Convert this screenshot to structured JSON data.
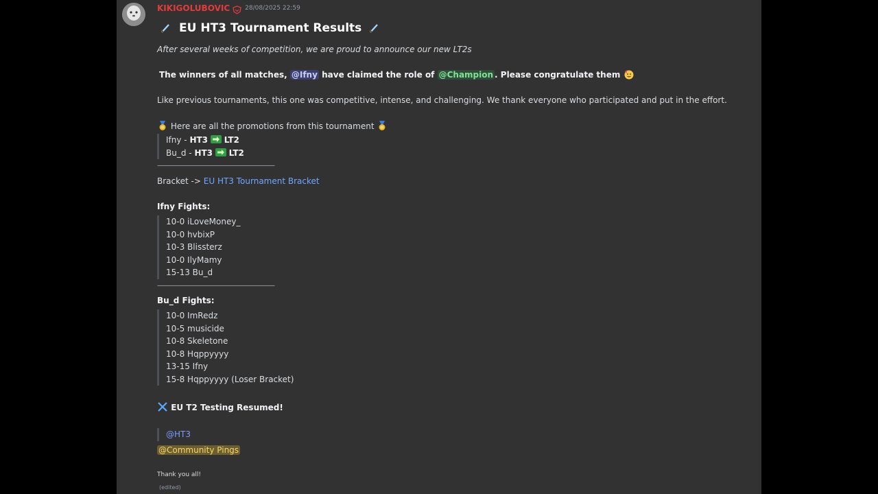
{
  "message": {
    "username": "KIKIGOLUBOVIC",
    "timestamp": "28/08/2025 22:59",
    "title": "EU HT3 Tournament Results",
    "intro": "After several weeks of competition, we are proud to announce our new LT2s",
    "winners": {
      "prefix": "The winners of all matches,",
      "mention_user": "@Ifny",
      "middle": "have claimed the role of",
      "mention_role": "@Champion",
      "suffix": ". Please congratulate them"
    },
    "thanks_paragraph": "Like previous tournaments, this one was competitive, intense, and challenging. We thank everyone who participated and put in the effort.",
    "promotions_heading": "Here are all the promotions from this tournament",
    "promotions": [
      {
        "name": "Ifny -",
        "from": "HT3",
        "to": "LT2"
      },
      {
        "name": "Bu_d -",
        "from": "HT3",
        "to": "LT2"
      }
    ],
    "separator_text": "———————————————————",
    "bracket": {
      "label": "Bracket ->",
      "link": "EU HT3 Tournament Bracket"
    },
    "ifny_heading": "Ifny Fights:",
    "ifny_fights": [
      "10-0 iLoveMoney_",
      "10-0 hvbixP",
      "10-3 Blissterz",
      "10-0 IlyMamy",
      "15-13 Bu_d"
    ],
    "bud_heading": "Bu_d Fights:",
    "bud_fights": [
      "10-0 ImRedz",
      "10-5 musicide",
      "10-8 Skeletone",
      "10-8 Hqppyyyy",
      "13-15 Ifny",
      "15-8 Hqppyyyy (Loser Bracket)"
    ],
    "testing_heading": "EU T2 Testing Resumed!",
    "mention_ht3": "@HT3",
    "mention_community": "@Community Pings",
    "closing": "Thank you all!",
    "edited": "(edited)"
  },
  "colors": {
    "username": "#e23b3b",
    "background": "#323233",
    "link": "#6ea8ff"
  }
}
